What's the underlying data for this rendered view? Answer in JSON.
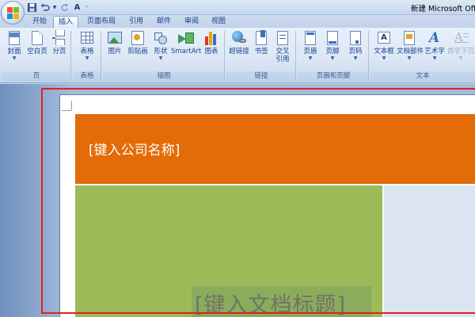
{
  "titlebar": {
    "window_title": "新建 Microsoft Offic",
    "qat": {
      "save_icon": "save-icon",
      "undo_icon": "undo-icon",
      "redo_icon": "redo-icon",
      "font_icon": "A"
    }
  },
  "tabs": [
    {
      "label": "开始",
      "active": false
    },
    {
      "label": "插入",
      "active": true
    },
    {
      "label": "页面布局",
      "active": false
    },
    {
      "label": "引用",
      "active": false
    },
    {
      "label": "邮件",
      "active": false
    },
    {
      "label": "审阅",
      "active": false
    },
    {
      "label": "视图",
      "active": false
    }
  ],
  "ribbon": {
    "groups": [
      {
        "label": "页",
        "buttons": [
          {
            "label": "封面",
            "dropdown": true
          },
          {
            "label": "空白页"
          },
          {
            "label": "分页"
          }
        ]
      },
      {
        "label": "表格",
        "buttons": [
          {
            "label": "表格",
            "dropdown": true
          }
        ]
      },
      {
        "label": "插图",
        "buttons": [
          {
            "label": "图片"
          },
          {
            "label": "剪贴画"
          },
          {
            "label": "形状",
            "dropdown": true
          },
          {
            "label": "SmartArt"
          },
          {
            "label": "图表"
          }
        ]
      },
      {
        "label": "链接",
        "buttons": [
          {
            "label": "超链接"
          },
          {
            "label": "书签"
          },
          {
            "label": "交叉",
            "label2": "引用"
          }
        ]
      },
      {
        "label": "页眉和页脚",
        "buttons": [
          {
            "label": "页眉",
            "dropdown": true
          },
          {
            "label": "页脚",
            "dropdown": true
          },
          {
            "label": "页码",
            "dropdown": true
          }
        ]
      },
      {
        "label": "文本",
        "buttons": [
          {
            "label": "文本框",
            "dropdown": true
          },
          {
            "label": "文档部件",
            "dropdown": true
          },
          {
            "label": "艺术字",
            "dropdown": true
          },
          {
            "label": "首字下沉",
            "dropdown": true,
            "disabled": true
          }
        ]
      }
    ]
  },
  "document": {
    "company_placeholder": "[键入公司名称]",
    "title_placeholder": "[键入文档标题]",
    "colors": {
      "orange": "#e36c09",
      "green": "#9bbb59",
      "light_blue": "#dbe5f1",
      "highlight_red": "#e02020"
    }
  }
}
